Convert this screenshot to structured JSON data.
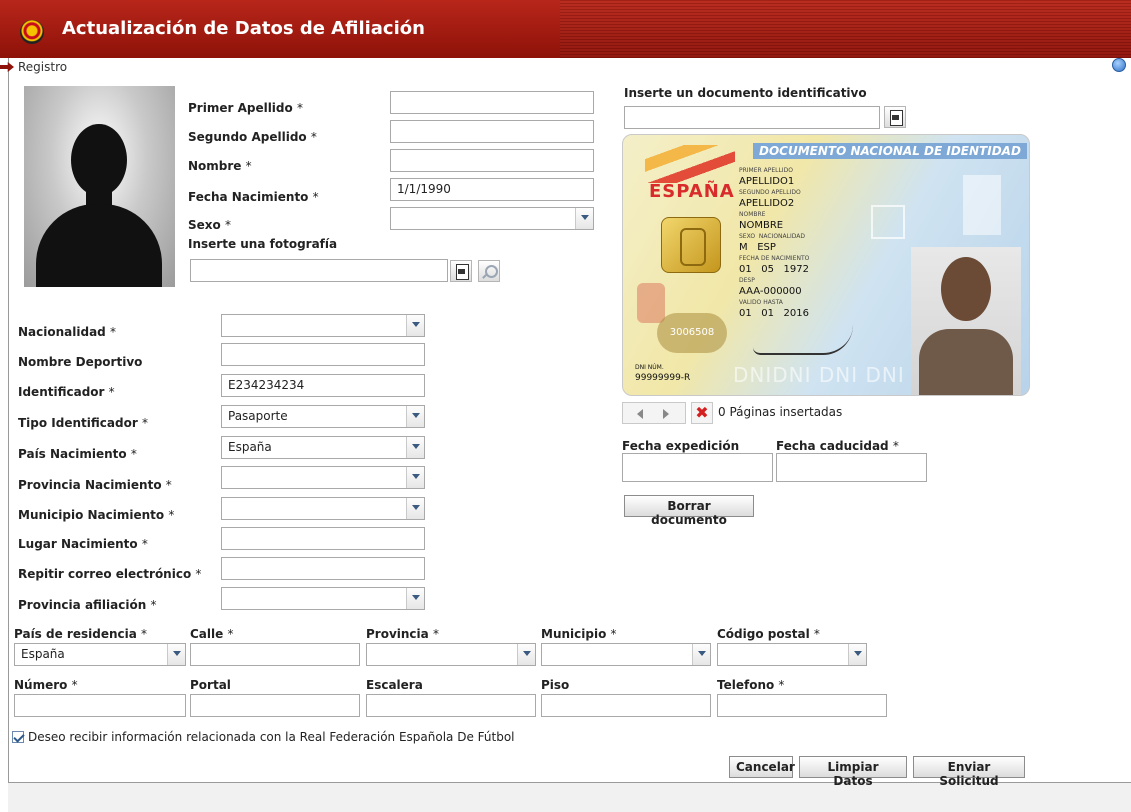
{
  "header": {
    "title": "Actualización de Datos de Afiliación"
  },
  "breadcrumb": {
    "label": "Registro"
  },
  "personal": {
    "primer_apellido": {
      "label": "Primer Apellido",
      "value": ""
    },
    "segundo_apellido": {
      "label": "Segundo Apellido",
      "value": ""
    },
    "nombre": {
      "label": "Nombre",
      "value": ""
    },
    "fecha_nacimiento": {
      "label": "Fecha Nacimiento",
      "value": "1/1/1990"
    },
    "sexo": {
      "label": "Sexo",
      "value": ""
    },
    "foto_label": "Inserte una fotografía"
  },
  "required_mark": "*",
  "details": {
    "nacionalidad": {
      "label": "Nacionalidad",
      "value": ""
    },
    "nombre_deportivo": {
      "label": "Nombre Deportivo",
      "value": ""
    },
    "identificador": {
      "label": "Identificador",
      "value": "E234234234"
    },
    "tipo_identificador": {
      "label": "Tipo Identificador",
      "value": "Pasaporte"
    },
    "pais_nacimiento": {
      "label": "País Nacimiento",
      "value": "España"
    },
    "provincia_nacimiento": {
      "label": "Provincia Nacimiento",
      "value": ""
    },
    "municipio_nacimiento": {
      "label": "Municipio Nacimiento",
      "value": ""
    },
    "lugar_nacimiento": {
      "label": "Lugar Nacimiento",
      "value": ""
    },
    "repetir_correo": {
      "label": "Repitir correo electrónico",
      "value": ""
    },
    "provincia_afiliacion": {
      "label": "Provincia afiliación",
      "value": ""
    }
  },
  "address": {
    "pais_residencia": {
      "label": "País de residencia",
      "value": "España"
    },
    "calle": {
      "label": "Calle",
      "value": ""
    },
    "provincia": {
      "label": "Provincia",
      "value": ""
    },
    "municipio": {
      "label": "Municipio",
      "value": ""
    },
    "codigo_postal": {
      "label": "Código postal",
      "value": ""
    },
    "numero": {
      "label": "Número",
      "value": ""
    },
    "portal": {
      "label": "Portal",
      "value": ""
    },
    "escalera": {
      "label": "Escalera",
      "value": ""
    },
    "piso": {
      "label": "Piso",
      "value": ""
    },
    "telefono": {
      "label": "Telefono",
      "value": ""
    }
  },
  "document": {
    "label": "Inserte un documento identificativo",
    "pages_text": "0 Páginas insertadas",
    "fecha_expedicion": {
      "label": "Fecha expedición",
      "value": ""
    },
    "fecha_caducidad": {
      "label": "Fecha caducidad",
      "value": ""
    },
    "delete_button": "Borrar documento"
  },
  "idcard": {
    "header": "DOCUMENTO NACIONAL DE IDENTIDAD",
    "country": "ESPAÑA",
    "primer_apellido_label": "PRIMER APELLIDO",
    "primer_apellido": "APELLIDO1",
    "segundo_apellido_label": "SEGUNDO APELLIDO",
    "segundo_apellido": "APELLIDO2",
    "nombre_label": "NOMBRE",
    "nombre": "NOMBRE",
    "sexo_label": "SEXO",
    "nacionalidad_label": "NACIONALIDAD",
    "sexo": "M",
    "nacionalidad": "ESP",
    "fecha_nac_label": "FECHA DE NACIMIENTO",
    "fecha_nac": "01   05   1972",
    "desp_label": "DESP",
    "desp": "AAA-000000",
    "valido_label": "VALIDO HASTA",
    "valido": "01   01   2016",
    "seal": "3006508",
    "dni_num_label": "DNI NÚM.",
    "dni_num": "99999999-R",
    "strip": "DNIDNI DNI DNI DNI"
  },
  "consent": {
    "label": "Deseo recibir información relacionada con la Real Federación Española De Fútbol",
    "checked": true
  },
  "actions": {
    "cancel": "Cancelar",
    "clear": "Limpiar Datos",
    "submit": "Enviar Solicitud"
  }
}
